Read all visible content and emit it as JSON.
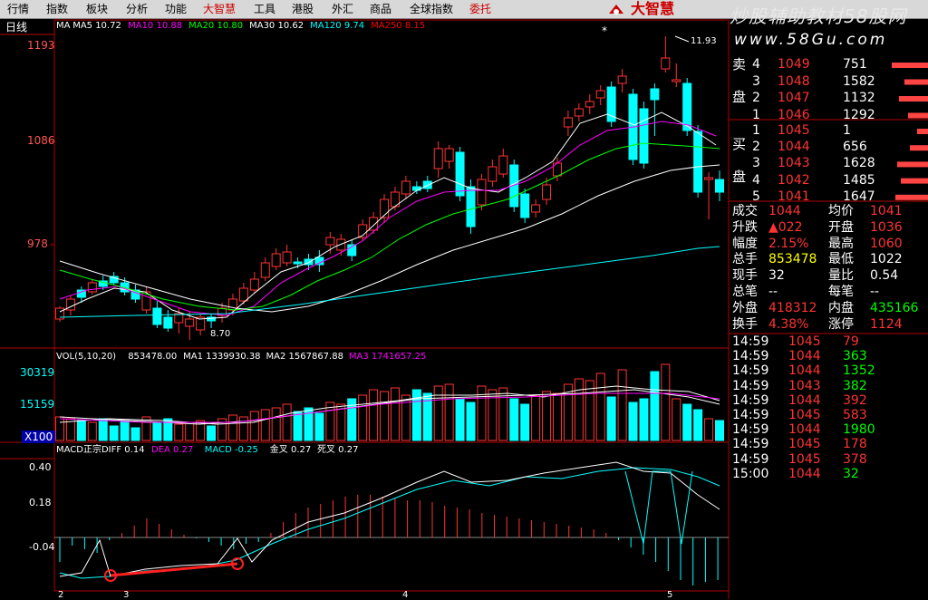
{
  "menubar": {
    "items": [
      "行情",
      "指数",
      "板块",
      "分析",
      "功能",
      "大智慧",
      "工具",
      "港股",
      "外汇",
      "商品",
      "全球指数",
      "委托"
    ],
    "red_items": [
      5,
      11
    ],
    "brand": "大智慧",
    "watermark": "炒股辅助教材58股网",
    "watermark_url": "www.58Gu.com"
  },
  "chart": {
    "period": "日线",
    "ma_legend": [
      {
        "text": "MA",
        "color": "#ffffff"
      },
      {
        "text": "MA5 10.72",
        "color": "#ffffff"
      },
      {
        "text": "MA10 10.88",
        "color": "#ff00ff"
      },
      {
        "text": "MA20 10.80",
        "color": "#00ff00"
      },
      {
        "text": "MA30 10.62",
        "color": "#ffffff"
      },
      {
        "text": "MA120 9.74",
        "color": "#00ffff"
      },
      {
        "text": "MA250 8.15",
        "color": "#ff0000"
      }
    ],
    "price_ticks": [
      "1193",
      "1086",
      "978"
    ],
    "high_label": "11.93",
    "low_label": "8.70",
    "vol_legend": [
      {
        "text": "VOL(5,10,20)",
        "color": "#ffffff"
      },
      {
        "text": "853478.00",
        "color": "#ffffff"
      },
      {
        "text": "MA1 1339930.38",
        "color": "#ffffff"
      },
      {
        "text": "MA2 1567867.88",
        "color": "#ffffff"
      },
      {
        "text": "MA3 1741657.25",
        "color": "#ff00ff"
      }
    ],
    "vol_ticks": [
      "30319",
      "15159",
      "X100"
    ],
    "macd_legend": [
      {
        "text": "MACD正宗DIFF 0.14",
        "color": "#ffffff"
      },
      {
        "text": "DEA 0.27",
        "color": "#ff00ff"
      },
      {
        "text": "MACD -0.25",
        "color": "#00ffff"
      },
      {
        "text": "金叉 0.27",
        "color": "#ffffff"
      },
      {
        "text": "死叉 0.27",
        "color": "#ffffff"
      }
    ],
    "macd_ticks": [
      "0.40",
      "0.18",
      "-0.04"
    ],
    "date_ticks": [
      "2",
      "3",
      "4",
      "5"
    ]
  },
  "orderbook": {
    "sell_label": [
      "卖",
      "盘"
    ],
    "buy_label": [
      "买",
      "盘"
    ],
    "sell": [
      {
        "lvl": "4",
        "price": "1049",
        "vol": "751"
      },
      {
        "lvl": "3",
        "price": "1048",
        "vol": "1582"
      },
      {
        "lvl": "2",
        "price": "1047",
        "vol": "1132"
      },
      {
        "lvl": "1",
        "price": "1046",
        "vol": "1292"
      }
    ],
    "buy": [
      {
        "lvl": "1",
        "price": "1045",
        "vol": "1"
      },
      {
        "lvl": "2",
        "price": "1044",
        "vol": "656"
      },
      {
        "lvl": "3",
        "price": "1043",
        "vol": "1628"
      },
      {
        "lvl": "4",
        "price": "1042",
        "vol": "1485"
      },
      {
        "lvl": "5",
        "price": "1041",
        "vol": "1647"
      }
    ]
  },
  "quote": [
    {
      "k1": "成交",
      "v1": "1044",
      "k2": "均价",
      "v2": "1041"
    },
    {
      "k1": "升跌",
      "v1": "▲022",
      "k2": "开盘",
      "v2": "1036"
    },
    {
      "k1": "幅度",
      "v1": "2.15%",
      "k2": "最高",
      "v2": "1060"
    },
    {
      "k1": "总手",
      "v1": "853478",
      "k2": "最低",
      "v2": "1022"
    },
    {
      "k1": "现手",
      "v1": "32",
      "k2": "量比",
      "v2": "0.54"
    },
    {
      "k1": "总笔",
      "v1": "--",
      "k2": "每笔",
      "v2": "--"
    },
    {
      "k1": "外盘",
      "v1": "418312",
      "k2": "内盘",
      "v2": "435166"
    },
    {
      "k1": "换手",
      "v1": "4.38%",
      "k2": "涨停",
      "v2": "1124"
    }
  ],
  "ticks": [
    {
      "time": "14:59",
      "price": "1045",
      "vol": "79",
      "dir": "up"
    },
    {
      "time": "14:59",
      "price": "1044",
      "vol": "363",
      "dir": "dn"
    },
    {
      "time": "14:59",
      "price": "1044",
      "vol": "1352",
      "dir": "dn"
    },
    {
      "time": "14:59",
      "price": "1043",
      "vol": "382",
      "dir": "dn"
    },
    {
      "time": "14:59",
      "price": "1044",
      "vol": "392",
      "dir": "up"
    },
    {
      "time": "14:59",
      "price": "1045",
      "vol": "583",
      "dir": "up"
    },
    {
      "time": "14:59",
      "price": "1044",
      "vol": "1980",
      "dir": "dn"
    },
    {
      "time": "14:59",
      "price": "1045",
      "vol": "178",
      "dir": "up"
    },
    {
      "time": "14:59",
      "price": "1045",
      "vol": "378",
      "dir": "up"
    },
    {
      "time": "15:00",
      "price": "1044",
      "vol": "32",
      "dir": "dn"
    }
  ],
  "colors": {
    "up": "#ff3333",
    "down": "#00ffff",
    "frame": "#b00000",
    "green": "#00ff00",
    "yellow": "#ffff00"
  }
}
